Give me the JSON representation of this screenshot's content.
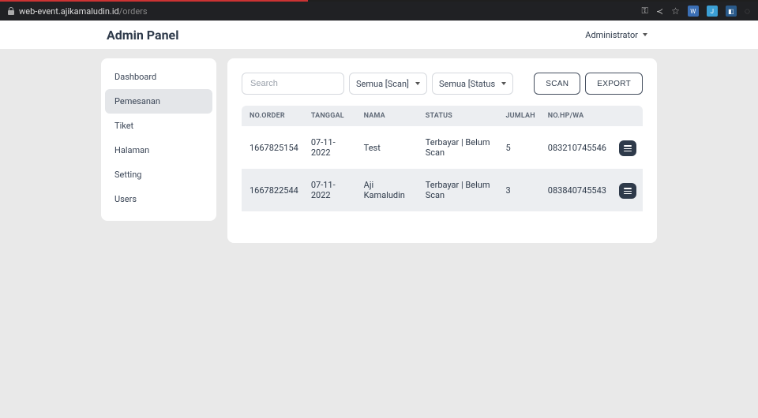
{
  "url": {
    "domain": "web-event.ajikamaludin.id",
    "path": "/orders"
  },
  "header": {
    "title": "Admin Panel",
    "user_label": "Administrator"
  },
  "sidebar": {
    "items": [
      {
        "label": "Dashboard",
        "active": false
      },
      {
        "label": "Pemesanan",
        "active": true
      },
      {
        "label": "Tiket",
        "active": false
      },
      {
        "label": "Halaman",
        "active": false
      },
      {
        "label": "Setting",
        "active": false
      },
      {
        "label": "Users",
        "active": false
      }
    ]
  },
  "toolbar": {
    "search_placeholder": "Search",
    "filter_scan": "Semua [Scan]",
    "filter_status": "Semua [Status",
    "scan_label": "SCAN",
    "export_label": "EXPORT"
  },
  "table": {
    "headers": {
      "no_order": "NO.ORDER",
      "tanggal": "TANGGAL",
      "nama": "NAMA",
      "status": "STATUS",
      "jumlah": "JUMLAH",
      "nohp": "NO.HP/WA"
    },
    "rows": [
      {
        "no_order": "1667825154",
        "tanggal": "07-11-2022",
        "nama": "Test",
        "status": "Terbayar | Belum Scan",
        "jumlah": "5",
        "nohp": "083210745546"
      },
      {
        "no_order": "1667822544",
        "tanggal": "07-11-2022",
        "nama": "Aji Kamaludin",
        "status": "Terbayar | Belum Scan",
        "jumlah": "3",
        "nohp": "083840745543"
      }
    ]
  }
}
